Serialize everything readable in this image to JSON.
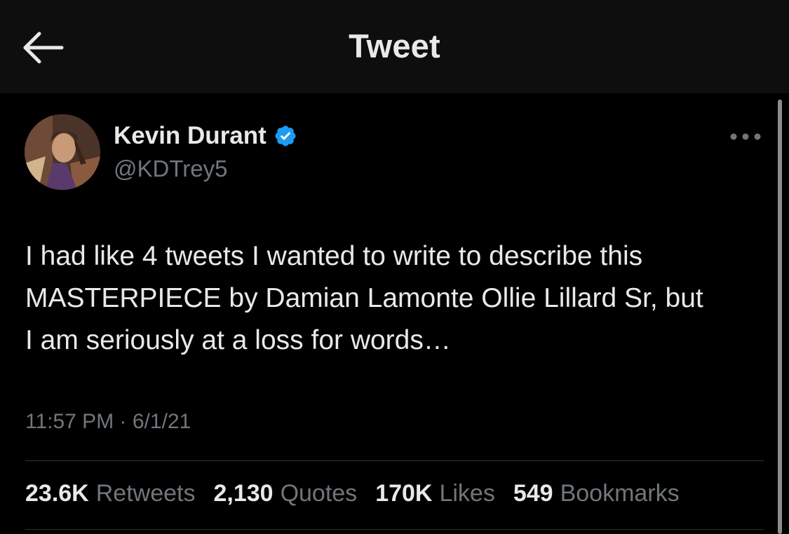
{
  "header": {
    "title": "Tweet",
    "back_icon": "arrow-left-icon"
  },
  "author": {
    "name": "Kevin Durant",
    "handle": "@KDTrey5",
    "verified_icon": "verified-badge-icon",
    "verified_color": "#1d9bf0"
  },
  "tweet": {
    "text": "I had like 4 tweets I wanted to write to describe this\nMASTERPIECE by Damian Lamonte Ollie Lillard Sr, but\nI am seriously at a loss for words…",
    "time": "11:57 PM",
    "separator": "·",
    "date": "6/1/21"
  },
  "stats": [
    {
      "value": "23.6K",
      "label": "Retweets"
    },
    {
      "value": "2,130",
      "label": "Quotes"
    },
    {
      "value": "170K",
      "label": "Likes"
    },
    {
      "value": "549",
      "label": "Bookmarks"
    }
  ],
  "colors": {
    "background": "#000000",
    "header_bg": "#0e0e0e",
    "primary_text": "#e7e9ea",
    "secondary_text": "#71767b",
    "divider": "#2f3336"
  }
}
